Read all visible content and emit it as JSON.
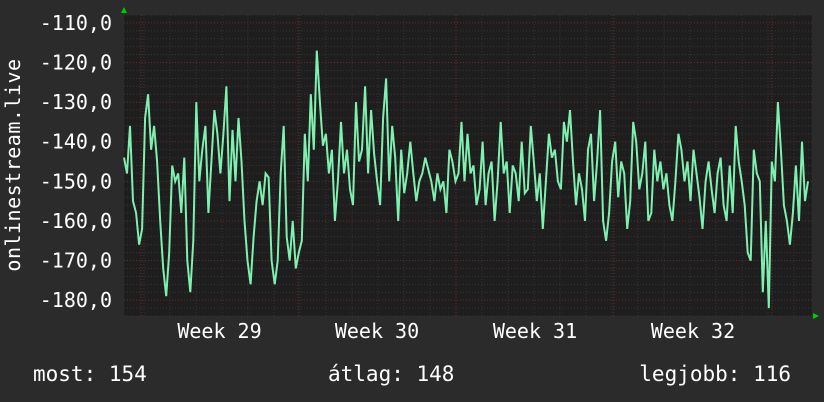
{
  "chart_data": {
    "type": "line",
    "ylabel": "onlinestream.live",
    "y_ticks": [
      "-110,0",
      "-120,0",
      "-130,0",
      "-140,0",
      "-150,0",
      "-160,0",
      "-170,0",
      "-180,0"
    ],
    "x_ticks": [
      "Week 29",
      "Week 30",
      "Week 31",
      "Week 32"
    ],
    "ylim": [
      -184,
      -108
    ],
    "grid": true,
    "colors": {
      "background": "#2b2b2b",
      "plot_background": "#1e1e1e",
      "line": "#7ff0b0",
      "major_grid": "#6a2a2a",
      "minor_grid": "#3c3333",
      "axis_arrow": "#00cc00"
    },
    "series": [
      {
        "values": [
          -144,
          -148,
          -136,
          -155,
          -158,
          -166,
          -162,
          -134,
          -128,
          -142,
          -136,
          -145,
          -160,
          -172,
          -179,
          -168,
          -146,
          -150,
          -148,
          -158,
          -144,
          -170,
          -178,
          -165,
          -130,
          -150,
          -142,
          -136,
          -158,
          -145,
          -132,
          -138,
          -148,
          -138,
          -126,
          -155,
          -137,
          -150,
          -134,
          -145,
          -160,
          -170,
          -176,
          -164,
          -155,
          -150,
          -156,
          -148,
          -149,
          -170,
          -176,
          -170,
          -148,
          -136,
          -164,
          -170,
          -160,
          -172,
          -168,
          -165,
          -138,
          -150,
          -128,
          -142,
          -117,
          -130,
          -141,
          -138,
          -148,
          -142,
          -160,
          -150,
          -135,
          -148,
          -142,
          -152,
          -156,
          -130,
          -145,
          -142,
          -126,
          -148,
          -132,
          -143,
          -150,
          -156,
          -134,
          -124,
          -150,
          -136,
          -144,
          -160,
          -142,
          -153,
          -148,
          -140,
          -148,
          -155,
          -150,
          -148,
          -144,
          -147,
          -150,
          -155,
          -148,
          -152,
          -150,
          -158,
          -142,
          -145,
          -150,
          -148,
          -135,
          -150,
          -138,
          -148,
          -146,
          -156,
          -152,
          -140,
          -156,
          -148,
          -145,
          -160,
          -150,
          -135,
          -148,
          -145,
          -158,
          -146,
          -148,
          -155,
          -140,
          -153,
          -152,
          -136,
          -145,
          -155,
          -148,
          -162,
          -150,
          -138,
          -144,
          -142,
          -150,
          -152,
          -135,
          -140,
          -132,
          -145,
          -156,
          -148,
          -152,
          -160,
          -142,
          -138,
          -155,
          -145,
          -132,
          -160,
          -165,
          -158,
          -145,
          -140,
          -154,
          -145,
          -148,
          -162,
          -155,
          -135,
          -140,
          -152,
          -148,
          -140,
          -160,
          -158,
          -142,
          -150,
          -145,
          -152,
          -148,
          -156,
          -160,
          -150,
          -138,
          -142,
          -150,
          -145,
          -155,
          -142,
          -148,
          -154,
          -162,
          -150,
          -145,
          -152,
          -158,
          -148,
          -144,
          -156,
          -160,
          -146,
          -158,
          -136,
          -145,
          -150,
          -156,
          -168,
          -170,
          -142,
          -148,
          -150,
          -178,
          -160,
          -182,
          -145,
          -150,
          -130,
          -142,
          -156,
          -160,
          -166,
          -158,
          -146,
          -160,
          -140,
          -155,
          -150
        ]
      }
    ]
  },
  "stats": {
    "now": "most: 154",
    "avg": "átlag: 148",
    "best": "legjobb: 116"
  }
}
